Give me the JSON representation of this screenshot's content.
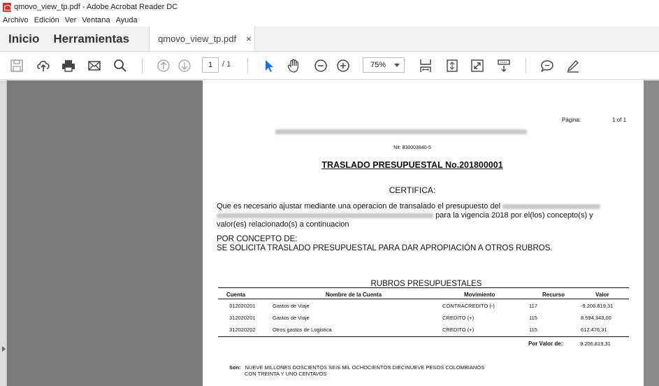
{
  "window": {
    "title": "qmovo_view_tp.pdf - Adobe Acrobat Reader DC"
  },
  "menu": [
    "Archivo",
    "Edición",
    "Ver",
    "Ventana",
    "Ayuda"
  ],
  "tabs": {
    "home": "Inicio",
    "tools": "Herramientas",
    "document": "qmovo_view_tp.pdf",
    "close": "×"
  },
  "toolbar": {
    "page_current": "1",
    "page_total": "/ 1",
    "zoom": "75%",
    "icons": [
      "save-icon",
      "upload-cloud-icon",
      "print-icon",
      "email-icon",
      "search-icon",
      "page-up-icon",
      "page-down-icon",
      "select-arrow-icon",
      "hand-icon",
      "zoom-out-icon",
      "zoom-in-icon",
      "fit-width-icon",
      "fit-page-icon",
      "fullscreen-icon",
      "read-mode-icon",
      "comment-icon",
      "sign-icon"
    ]
  },
  "document": {
    "pagina_label": "Página:",
    "pagina_value": "1 of 1",
    "nit": "Nit: 830003840-5",
    "title": "TRASLADO PRESUPUESTAL No.201800001",
    "certifica": "CERTIFICA:",
    "body_line1": "Que es necesario ajustar mediante una operacion de transalado  el presupuesto del",
    "body_line2": "para la vigencia 2018 por el(los) concepto(s) y",
    "body_line3": "valor(es) relacionado(s) a continuacion",
    "por_concepto": "POR CONCEPTO DE:",
    "concepto": "SE SOLICITA TRASLADO PRESUPUESTAL PARA DAR APROPIACIÓN A OTROS RUBROS.",
    "rubros_title": "RUBROS PRESUPUESTALES",
    "headers": {
      "cuenta": "Cuenta",
      "nombre": "Nombre de la Cuenta",
      "movimiento": "Movimiento",
      "recurso": "Recurso",
      "valor": "Valor"
    },
    "rows": [
      {
        "cuenta": "312020201",
        "nombre": "Gastos de Viaje",
        "movimiento": "CONTRACREDITO (-)",
        "recurso": "117",
        "valor": "-9.206.819,31"
      },
      {
        "cuenta": "312020201",
        "nombre": "Gastos de Viaje",
        "movimiento": "CREDITO (+)",
        "recurso": "115",
        "valor": "8.594.343,00"
      },
      {
        "cuenta": "312020202",
        "nombre": "Otros gastos de Logistica",
        "movimiento": "CREDITO (+)",
        "recurso": "115",
        "valor": "612.476,31"
      }
    ],
    "total_label": "Por Valor de:",
    "total_value": "9.206.819,31",
    "son_label": "Son:",
    "son_line1": "NUEVE  MILLONES DOSCIENTOS SEIS  MIL OCHOCIENTOS DIECINUEVE  PESOS COLOMBIANOS",
    "son_line2": "CON TREINTA Y UNO CENTAVOS"
  }
}
